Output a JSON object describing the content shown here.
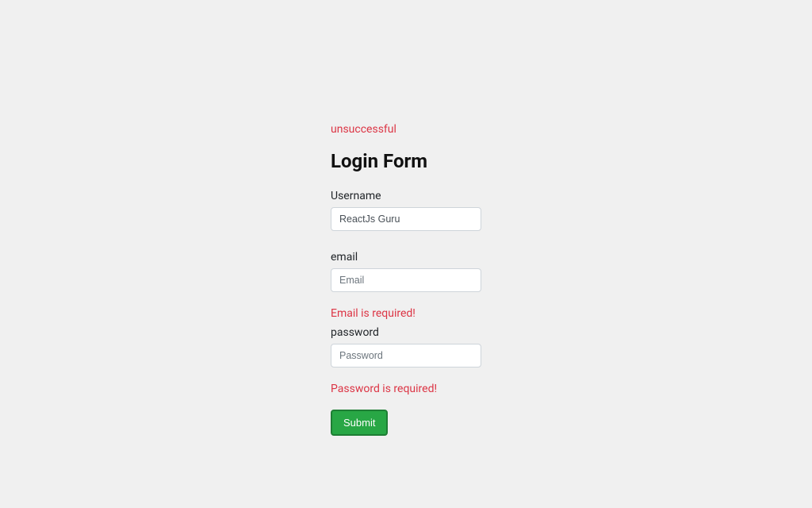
{
  "status": {
    "message": "unsuccessful"
  },
  "form": {
    "title": "Login Form",
    "username": {
      "label": "Username",
      "value": "ReactJs Guru"
    },
    "email": {
      "label": "email",
      "placeholder": "Email",
      "error": "Email is required!"
    },
    "password": {
      "label": "password",
      "placeholder": "Password",
      "error": "Password is required!"
    },
    "submit": {
      "label": "Submit"
    }
  },
  "colors": {
    "error": "#dc3545",
    "success": "#28a745",
    "background": "#f0f0f0"
  }
}
